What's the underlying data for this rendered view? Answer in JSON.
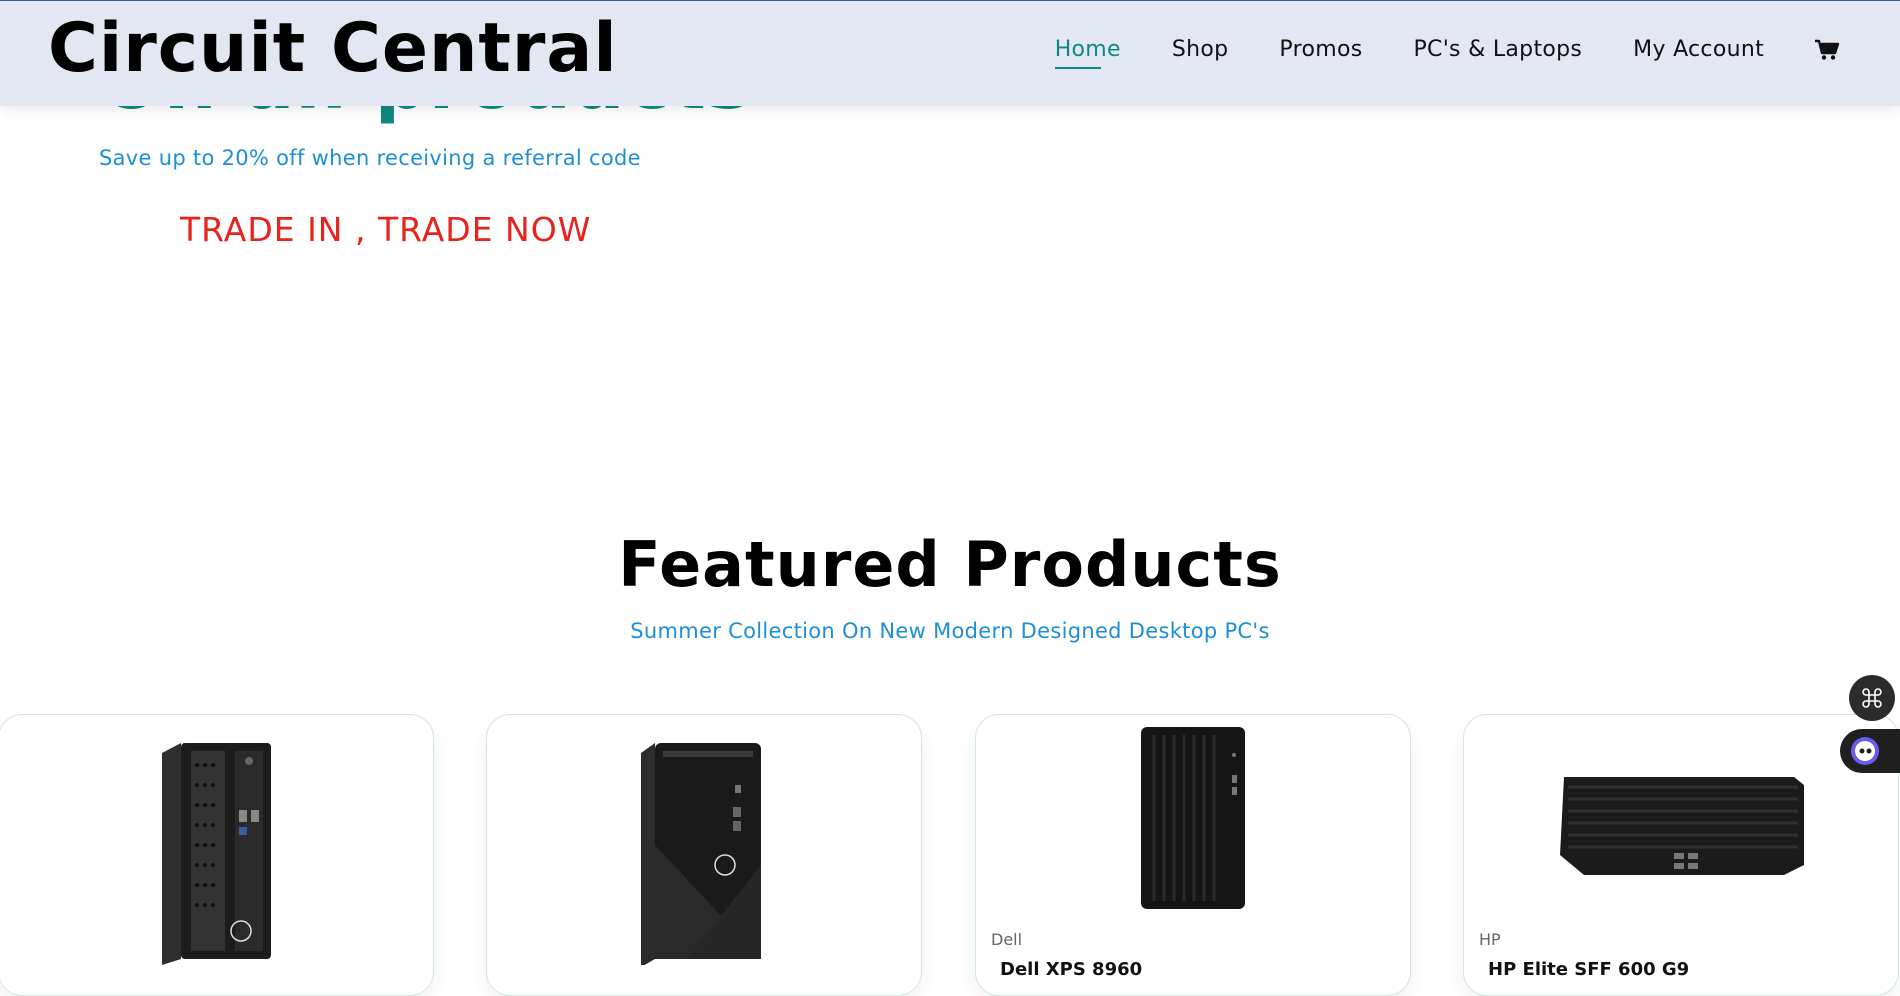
{
  "hero": {
    "headline_partial": "On all products",
    "subtitle": "Save up to 20% off when receiving a referral code",
    "trade_text": "TRADE IN , TRADE NOW"
  },
  "header": {
    "logo": "Circuit Central",
    "nav": [
      {
        "label": "Home",
        "active": true
      },
      {
        "label": "Shop"
      },
      {
        "label": "Promos"
      },
      {
        "label": "PC's & Laptops"
      },
      {
        "label": "My Account"
      }
    ],
    "cart_icon": "cart-icon"
  },
  "featured": {
    "title": "Featured Products",
    "subtitle": "Summer Collection On New Modern Designed Desktop PC's"
  },
  "products": [
    {
      "brand": "",
      "name": ""
    },
    {
      "brand": "",
      "name": ""
    },
    {
      "brand": "Dell",
      "name": "Dell XPS 8960"
    },
    {
      "brand": "HP",
      "name": "HP Elite SFF 600 G9"
    }
  ],
  "widgets": {
    "command_icon": "command-icon",
    "assistant_icon": "assistant-icon"
  },
  "colors": {
    "accent": "#0f8a7e",
    "link_blue": "#1e8fd6",
    "promo_red": "#e8231c",
    "header_bg": "#e3e7f2"
  }
}
